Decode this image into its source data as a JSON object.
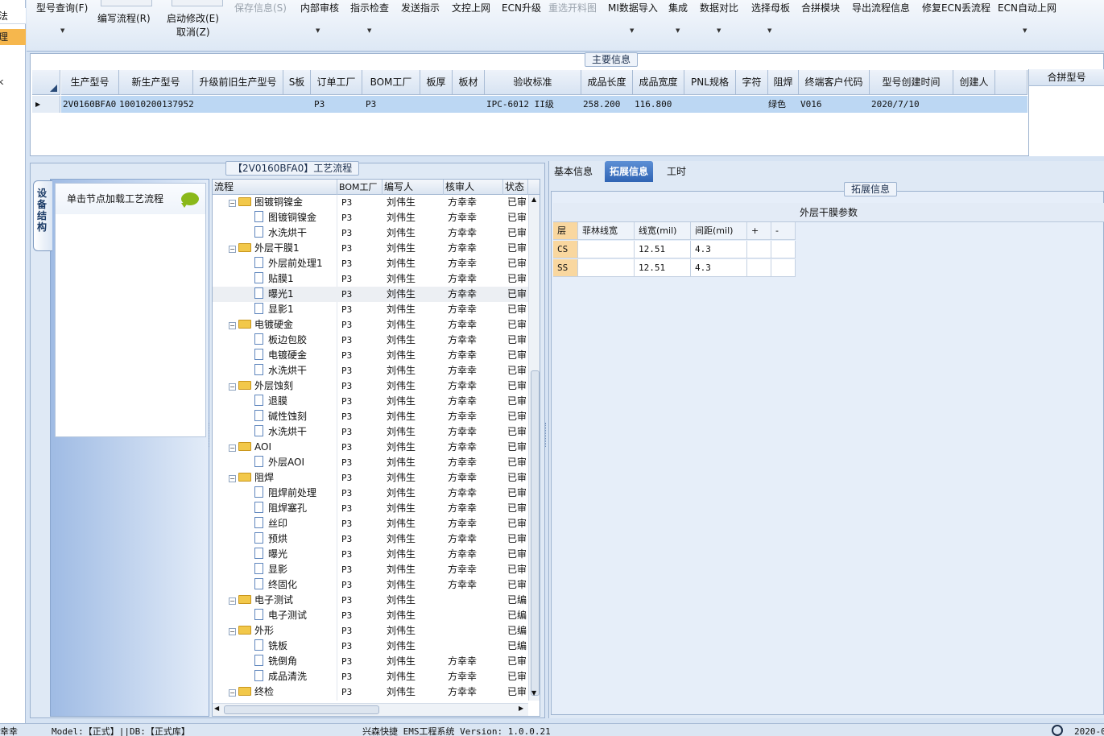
{
  "left_nav": {
    "items": [
      "法",
      "理",
      "k"
    ]
  },
  "toolbar": {
    "buttons": [
      {
        "label": "型号查询(F)",
        "enabled": true
      },
      {
        "label": "编写流程(R)",
        "enabled": true
      },
      {
        "label": "启动修改(E)",
        "enabled": true
      },
      {
        "label": "取消(Z)",
        "enabled": true
      },
      {
        "label": "保存信息(S)",
        "enabled": false
      },
      {
        "label": "内部审核",
        "enabled": true
      },
      {
        "label": "指示检查",
        "enabled": true
      },
      {
        "label": "发送指示",
        "enabled": true
      },
      {
        "label": "文控上网",
        "enabled": true
      },
      {
        "label": "ECN升级",
        "enabled": true
      },
      {
        "label": "重选开料图",
        "enabled": false
      },
      {
        "label": "MI数据导入",
        "enabled": true
      },
      {
        "label": "集成",
        "enabled": true
      },
      {
        "label": "数据对比",
        "enabled": true
      },
      {
        "label": "选择母板",
        "enabled": true
      },
      {
        "label": "合拼模块",
        "enabled": true
      },
      {
        "label": "导出流程信息",
        "enabled": true
      },
      {
        "label": "修复ECN丢流程",
        "enabled": true
      },
      {
        "label": "ECN自动上网",
        "enabled": true
      }
    ]
  },
  "main_info": {
    "title": "主要信息",
    "columns": [
      "生产型号",
      "新生产型号",
      "升级前旧生产型号",
      "S板",
      "订单工厂",
      "BOM工厂",
      "板厚",
      "板材",
      "验收标准",
      "成品长度",
      "成品宽度",
      "PNL规格",
      "字符",
      "阻焊",
      "终端客户代码",
      "型号创建时间",
      "创建人"
    ],
    "row": [
      "2V0160BFA0",
      "10010200137952",
      "",
      "",
      "P3",
      "P3",
      "",
      "",
      "IPC-6012 II级",
      "258.200",
      "116.800",
      "",
      "",
      "绿色",
      "V016",
      "2020/7/10",
      ""
    ],
    "side_header": "合拼型号"
  },
  "process": {
    "title": "【2V0160BFA0】工艺流程",
    "side_tab": "设备结构",
    "node_hint": "单击节点加载工艺流程",
    "columns": [
      "流程",
      "BOM工厂",
      "编写人",
      "核审人",
      "状态"
    ],
    "rows": [
      {
        "level": 0,
        "name": "图镀铜镍金",
        "bom": "P3",
        "writer": "刘伟生",
        "reviewer": "方幸幸",
        "status": "已审"
      },
      {
        "level": 1,
        "name": "图镀铜镍金",
        "bom": "P3",
        "writer": "刘伟生",
        "reviewer": "方幸幸",
        "status": "已审"
      },
      {
        "level": 1,
        "name": "水洗烘干",
        "bom": "P3",
        "writer": "刘伟生",
        "reviewer": "方幸幸",
        "status": "已审"
      },
      {
        "level": 0,
        "name": "外层干膜1",
        "bom": "P3",
        "writer": "刘伟生",
        "reviewer": "方幸幸",
        "status": "已审"
      },
      {
        "level": 1,
        "name": "外层前处理1",
        "bom": "P3",
        "writer": "刘伟生",
        "reviewer": "方幸幸",
        "status": "已审"
      },
      {
        "level": 1,
        "name": "贴膜1",
        "bom": "P3",
        "writer": "刘伟生",
        "reviewer": "方幸幸",
        "status": "已审"
      },
      {
        "level": 1,
        "name": "曝光1",
        "bom": "P3",
        "writer": "刘伟生",
        "reviewer": "方幸幸",
        "status": "已审",
        "selected": true
      },
      {
        "level": 1,
        "name": "显影1",
        "bom": "P3",
        "writer": "刘伟生",
        "reviewer": "方幸幸",
        "status": "已审"
      },
      {
        "level": 0,
        "name": "电镀硬金",
        "bom": "P3",
        "writer": "刘伟生",
        "reviewer": "方幸幸",
        "status": "已审"
      },
      {
        "level": 1,
        "name": "板边包胶",
        "bom": "P3",
        "writer": "刘伟生",
        "reviewer": "方幸幸",
        "status": "已审"
      },
      {
        "level": 1,
        "name": "电镀硬金",
        "bom": "P3",
        "writer": "刘伟生",
        "reviewer": "方幸幸",
        "status": "已审"
      },
      {
        "level": 1,
        "name": "水洗烘干",
        "bom": "P3",
        "writer": "刘伟生",
        "reviewer": "方幸幸",
        "status": "已审"
      },
      {
        "level": 0,
        "name": "外层蚀刻",
        "bom": "P3",
        "writer": "刘伟生",
        "reviewer": "方幸幸",
        "status": "已审"
      },
      {
        "level": 1,
        "name": "退膜",
        "bom": "P3",
        "writer": "刘伟生",
        "reviewer": "方幸幸",
        "status": "已审"
      },
      {
        "level": 1,
        "name": "碱性蚀刻",
        "bom": "P3",
        "writer": "刘伟生",
        "reviewer": "方幸幸",
        "status": "已审"
      },
      {
        "level": 1,
        "name": "水洗烘干",
        "bom": "P3",
        "writer": "刘伟生",
        "reviewer": "方幸幸",
        "status": "已审"
      },
      {
        "level": 0,
        "name": "AOI",
        "bom": "P3",
        "writer": "刘伟生",
        "reviewer": "方幸幸",
        "status": "已审"
      },
      {
        "level": 1,
        "name": "外层AOI",
        "bom": "P3",
        "writer": "刘伟生",
        "reviewer": "方幸幸",
        "status": "已审"
      },
      {
        "level": 0,
        "name": "阻焊",
        "bom": "P3",
        "writer": "刘伟生",
        "reviewer": "方幸幸",
        "status": "已审"
      },
      {
        "level": 1,
        "name": "阻焊前处理",
        "bom": "P3",
        "writer": "刘伟生",
        "reviewer": "方幸幸",
        "status": "已审"
      },
      {
        "level": 1,
        "name": "阻焊塞孔",
        "bom": "P3",
        "writer": "刘伟生",
        "reviewer": "方幸幸",
        "status": "已审"
      },
      {
        "level": 1,
        "name": "丝印",
        "bom": "P3",
        "writer": "刘伟生",
        "reviewer": "方幸幸",
        "status": "已审"
      },
      {
        "level": 1,
        "name": "预烘",
        "bom": "P3",
        "writer": "刘伟生",
        "reviewer": "方幸幸",
        "status": "已审"
      },
      {
        "level": 1,
        "name": "曝光",
        "bom": "P3",
        "writer": "刘伟生",
        "reviewer": "方幸幸",
        "status": "已审"
      },
      {
        "level": 1,
        "name": "显影",
        "bom": "P3",
        "writer": "刘伟生",
        "reviewer": "方幸幸",
        "status": "已审"
      },
      {
        "level": 1,
        "name": "终固化",
        "bom": "P3",
        "writer": "刘伟生",
        "reviewer": "方幸幸",
        "status": "已审"
      },
      {
        "level": 0,
        "name": "电子测试",
        "bom": "P3",
        "writer": "刘伟生",
        "reviewer": "",
        "status": "已编"
      },
      {
        "level": 1,
        "name": "电子测试",
        "bom": "P3",
        "writer": "刘伟生",
        "reviewer": "",
        "status": "已编"
      },
      {
        "level": 0,
        "name": "外形",
        "bom": "P3",
        "writer": "刘伟生",
        "reviewer": "",
        "status": "已编"
      },
      {
        "level": 1,
        "name": "铣板",
        "bom": "P3",
        "writer": "刘伟生",
        "reviewer": "",
        "status": "已编"
      },
      {
        "level": 1,
        "name": "铣倒角",
        "bom": "P3",
        "writer": "刘伟生",
        "reviewer": "方幸幸",
        "status": "已审"
      },
      {
        "level": 1,
        "name": "成品清洗",
        "bom": "P3",
        "writer": "刘伟生",
        "reviewer": "方幸幸",
        "status": "已审"
      },
      {
        "level": 0,
        "name": "终检",
        "bom": "P3",
        "writer": "刘伟生",
        "reviewer": "方幸幸",
        "status": "已审"
      }
    ]
  },
  "right_tabs": {
    "tabs": [
      "基本信息",
      "拓展信息",
      "工时"
    ],
    "active": 1
  },
  "ext_info": {
    "title": "拓展信息",
    "grid_title": "外层干膜参数",
    "columns": [
      "层",
      "菲林线宽",
      "线宽(mil)",
      "间距(mil)",
      "+",
      "-"
    ],
    "rows": [
      [
        "CS",
        "",
        "12.51",
        "4.3",
        "",
        ""
      ],
      [
        "SS",
        "",
        "12.51",
        "4.3",
        "",
        ""
      ]
    ]
  },
  "status_bar": {
    "user": "幸幸",
    "model": "Model:【正式】||DB:【正式库】",
    "app": "兴森快捷 EMS工程系统 Version: 1.0.0.21",
    "date": "2020-0"
  }
}
